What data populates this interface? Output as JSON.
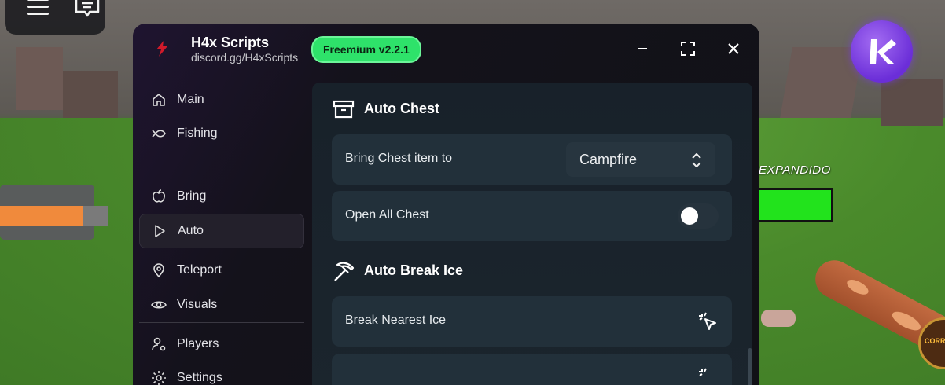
{
  "window": {
    "title": "H4x Scripts",
    "subtitle": "discord.gg/H4xScripts",
    "version_badge": "Freemium v2.2.1"
  },
  "sidebar": {
    "items": [
      {
        "label": "Main",
        "icon": "home-icon"
      },
      {
        "label": "Fishing",
        "icon": "fish-icon"
      },
      {
        "label": "Bring",
        "icon": "apple-icon"
      },
      {
        "label": "Auto",
        "icon": "play-icon",
        "active": true
      },
      {
        "label": "Teleport",
        "icon": "map-pin-icon"
      },
      {
        "label": "Visuals",
        "icon": "eye-icon"
      },
      {
        "label": "Players",
        "icon": "user-gear-icon"
      },
      {
        "label": "Settings",
        "icon": "gear-icon"
      }
    ]
  },
  "content": {
    "sections": [
      {
        "title": "Auto Chest",
        "icon": "archive-icon",
        "rows": [
          {
            "label": "Bring Chest item to",
            "type": "dropdown",
            "value": "Campfire"
          },
          {
            "label": "Open All Chest",
            "type": "toggle",
            "value": "off"
          }
        ]
      },
      {
        "title": "Auto Break Ice",
        "icon": "pickaxe-icon",
        "rows": [
          {
            "label": "Break Nearest Ice",
            "type": "button",
            "icon": "click-icon"
          }
        ]
      }
    ]
  },
  "game_hud": {
    "bar_label": "EXPANDIDO",
    "badge_text": "CORR"
  },
  "colors": {
    "accent_green": "#2ee26a",
    "bar_green": "#22e31c",
    "k_button_purple": "#7a3ce0",
    "orange_bar": "#f08a3c"
  }
}
